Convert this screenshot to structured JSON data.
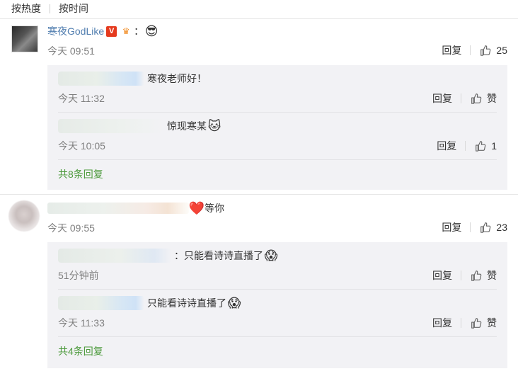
{
  "sort": {
    "hot": "按热度",
    "time": "按时间"
  },
  "comments": [
    {
      "username": "寒夜GodLike",
      "v_badge": "V",
      "vip_badge": "♛",
      "text": "：",
      "emoji": "😎",
      "time": "今天 09:51",
      "reply_label": "回复",
      "likes": "25",
      "replies": [
        {
          "text": "寒夜老师好！",
          "time": "今天 11:32",
          "reply_label": "回复",
          "likes": "赞"
        },
        {
          "text": "惊现寒某",
          "emoji": "🐱",
          "time": "今天 10:05",
          "reply_label": "回复",
          "likes": "1"
        }
      ],
      "more_label": "共8条回复"
    },
    {
      "emoji_heart": "❤️",
      "text": "等你",
      "time": "今天 09:55",
      "reply_label": "回复",
      "likes": "23",
      "replies": [
        {
          "text": "：只能看诗诗直播了",
          "emoji": "😱",
          "time": "51分钟前",
          "reply_label": "回复",
          "likes": "赞"
        },
        {
          "text": "只能看诗诗直播了",
          "emoji": "😱",
          "time": "今天 11:33",
          "reply_label": "回复",
          "likes": "赞"
        }
      ],
      "more_label": "共4条回复"
    }
  ],
  "colors": {
    "link_blue": "#507daf",
    "more_green": "#4c9a3c",
    "sub_bg": "#f2f2f5",
    "time_gray": "#808080"
  },
  "icons": {
    "like": "thumb-up-icon"
  }
}
